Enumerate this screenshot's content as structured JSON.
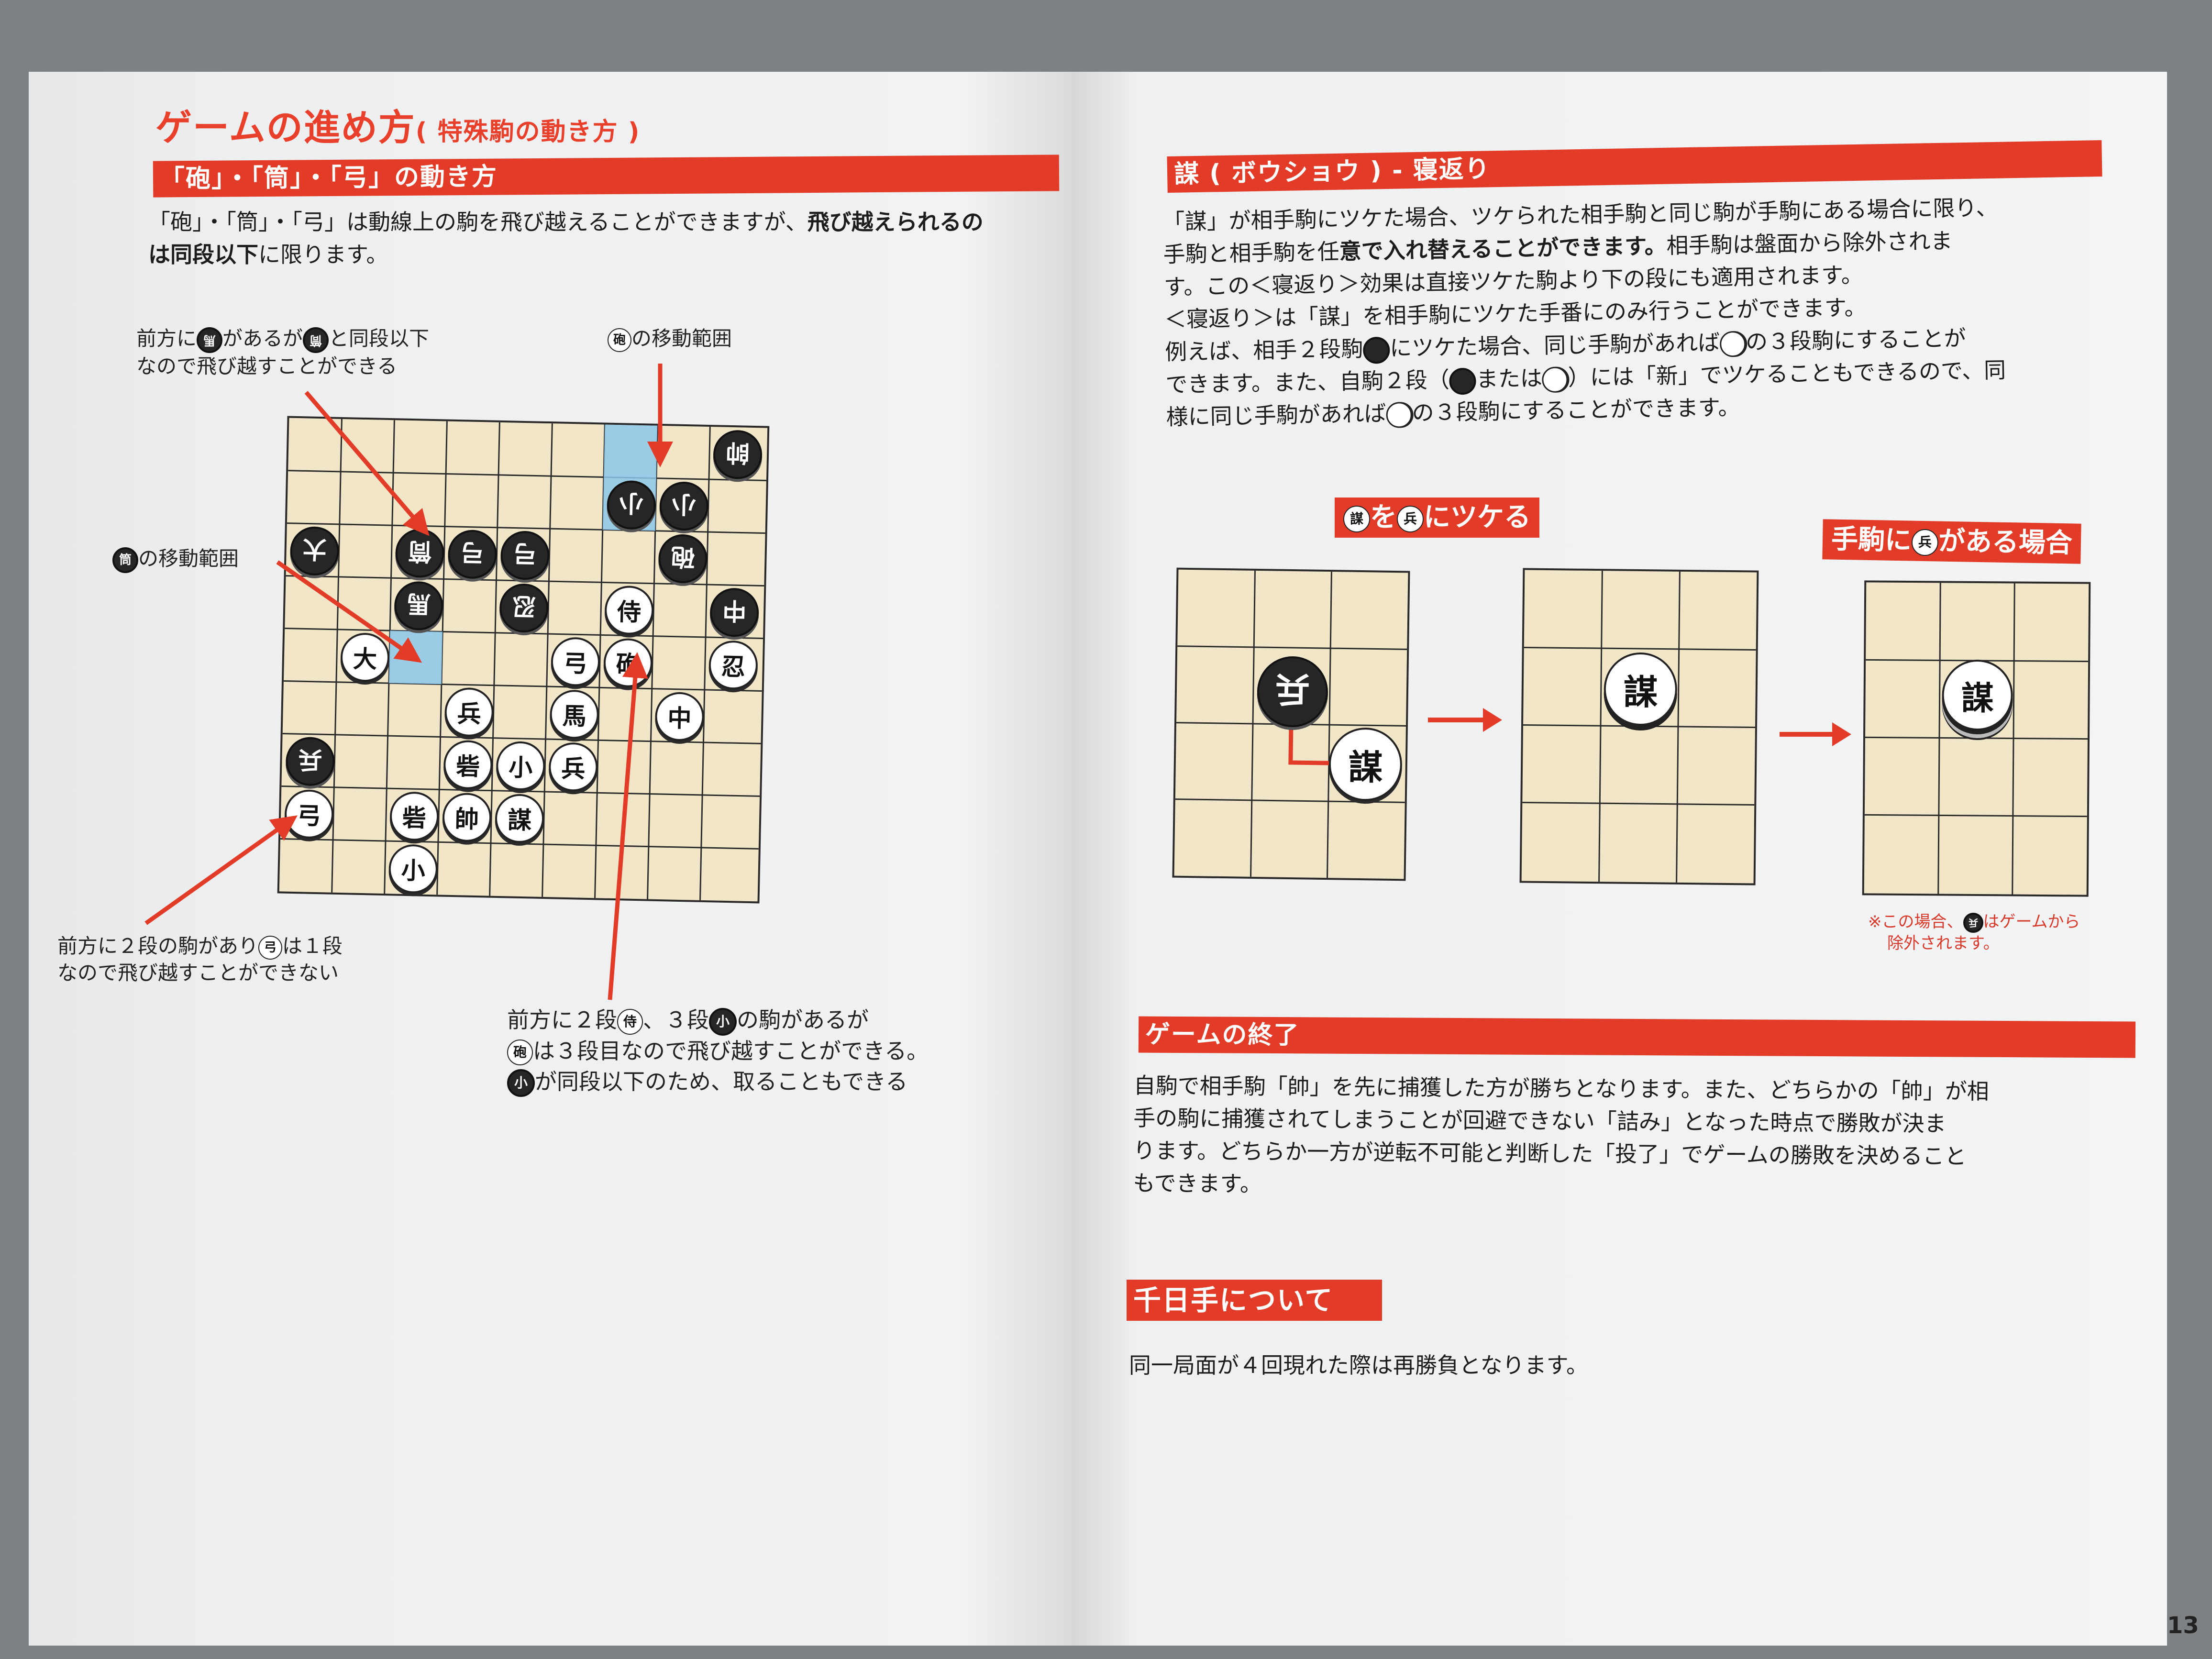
{
  "left": {
    "title": "ゲームの進め方",
    "title_sub": "( 特殊駒の動き方 )",
    "band": "「砲」・「筒」・「弓」の動き方",
    "intro_line1": "「砲」・「筒」・「弓」は動線上の駒を飛び越えることができますが、",
    "intro_bold1": "飛び越えられるの",
    "intro_line2_bold": "は同段以下",
    "intro_line2": "に限ります。",
    "callout_tl_line1": "前方に",
    "callout_tl_piece1": "馬",
    "callout_tl_mid": "があるが",
    "callout_tl_piece2": "筒",
    "callout_tl_end": "と同段以下",
    "callout_tl_line2": "なので飛び越すことができる",
    "callout_tr_piece": "砲",
    "callout_tr": "の移動範囲",
    "callout_ml_piece": "筒",
    "callout_ml": "の移動範囲",
    "callout_bl_line1a": "前方に２段の",
    "callout_bl_piece1": "駒",
    "callout_bl_line1b": "があり",
    "callout_bl_piece2": "弓",
    "callout_bl_line1c": "は１段",
    "callout_bl_line2": "なので飛び越すことができない",
    "callout_br_line1a": "前方に２段",
    "callout_br_piece1": "侍",
    "callout_br_line1b": "、３段",
    "callout_br_piece2": "小",
    "callout_br_line1c": "の駒があるが",
    "callout_br_piece3": "砲",
    "callout_br_line2": "は３段目なので飛び越すことができる。",
    "callout_br_piece4": "小",
    "callout_br_line3": "が同段以下のため、取ることもできる",
    "board_pieces": [
      {
        "char": "帥",
        "color": "b"
      },
      {
        "char": "小",
        "color": "b"
      },
      {
        "char": "小",
        "color": "b"
      },
      {
        "char": "大",
        "color": "b"
      },
      {
        "char": "筒",
        "color": "b"
      },
      {
        "char": "弓",
        "color": "b"
      },
      {
        "char": "弓",
        "color": "b"
      },
      {
        "char": "砲",
        "color": "b"
      },
      {
        "char": "馬",
        "color": "b"
      },
      {
        "char": "忍",
        "color": "b"
      },
      {
        "char": "侍",
        "color": "w"
      },
      {
        "char": "中",
        "color": "b"
      },
      {
        "char": "大",
        "color": "w"
      },
      {
        "char": "弓",
        "color": "w"
      },
      {
        "char": "砲",
        "color": "w"
      },
      {
        "char": "忍",
        "color": "w"
      },
      {
        "char": "兵",
        "color": "w"
      },
      {
        "char": "馬",
        "color": "w"
      },
      {
        "char": "中",
        "color": "w"
      },
      {
        "char": "兵",
        "color": "b"
      },
      {
        "char": "砦",
        "color": "w"
      },
      {
        "char": "小",
        "color": "w"
      },
      {
        "char": "兵",
        "color": "w"
      },
      {
        "char": "弓",
        "color": "w"
      },
      {
        "char": "砦",
        "color": "w"
      },
      {
        "char": "帥",
        "color": "w"
      },
      {
        "char": "謀",
        "color": "w"
      },
      {
        "char": "小",
        "color": "w"
      }
    ]
  },
  "right": {
    "band1": "謀 ( ボウショウ ) - 寝返り",
    "p1_l1": "「謀」が相手駒にツケた場合、ツケられた相手駒と同じ駒が手駒にある場合に限り、",
    "p1_l2a": "手駒と相手駒を任",
    "p1_l2b": "意で入れ替えることができます。",
    "p1_l2c": "相手駒は盤面から除外されま",
    "p1_l3": "す。この＜寝返り＞効果は直接ツケた駒より下の段にも適用されます。",
    "p1_l4": "＜寝返り＞は「謀」を相手駒にツケた手番にのみ行うことができます。",
    "p1_l5a": "例えば、相手２段駒",
    "p1_l5b": "にツケた場合、同じ手駒があれば",
    "p1_l5c": "の３段駒にすることが",
    "p1_l6a": "できます。また、自駒２段（",
    "p1_l6b": "または",
    "p1_l6c": "）には「新」でツケることもできるので、同",
    "p1_l7a": "様に同じ手駒があれば",
    "p1_l7b": "の３段駒にすることができます。",
    "label_a_piece1": "謀",
    "label_a_mid": "を",
    "label_a_piece2": "兵",
    "label_a_end": "にツケる",
    "label_b_start": "手駒に",
    "label_b_piece": "兵",
    "label_b_end": "がある場合",
    "diag_b1_piece_top": "兵",
    "diag_b1_piece_bottom": "謀",
    "diag_b2_piece": "謀",
    "diag_b3_piece": "謀",
    "note_a": "※この場合、",
    "note_piece": "兵",
    "note_b": "はゲームから",
    "note_c": "除外されます。",
    "band2": "ゲームの終了",
    "p2_l1": "自駒で相手駒「帥」を先に捕獲した方が勝ちとなります。また、どちらかの「帥」が相",
    "p2_l2": "手の駒に捕獲されてしまうことが回避できない「詰み」となった時点で勝敗が決ま",
    "p2_l3": "ります。どちらか一方が逆転不可能と判断した「投了」でゲームの勝敗を決めること",
    "p2_l4": "もできます。",
    "band3": "千日手について",
    "p3": "同一局面が４回現れた際は再勝負となります。"
  },
  "page_number": "13",
  "colors": {
    "accent": "#e23b27",
    "board": "#f2e6c9",
    "highlight": "#8cc7ea"
  }
}
